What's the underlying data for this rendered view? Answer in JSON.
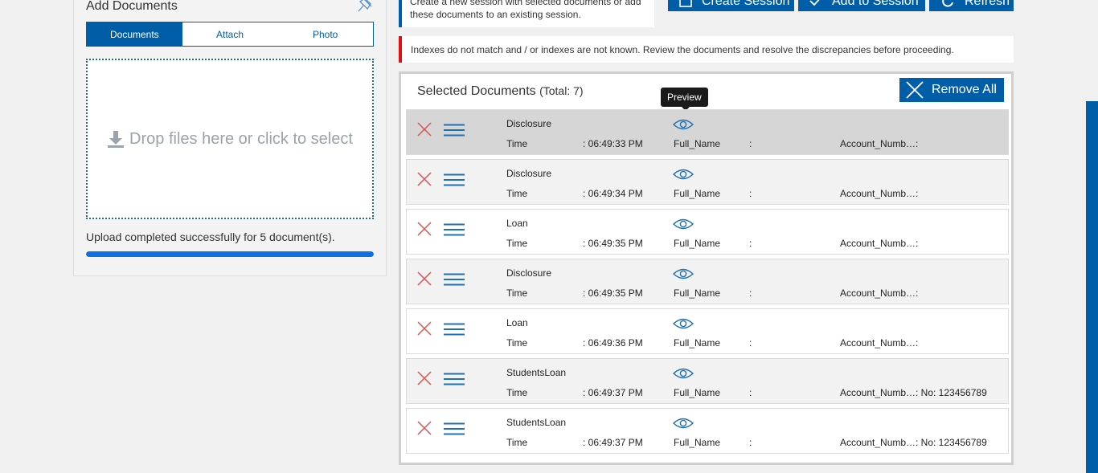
{
  "add_documents": {
    "title": "Add Documents",
    "tabs": [
      {
        "label": "Documents",
        "active": true
      },
      {
        "label": "Attach",
        "active": false
      },
      {
        "label": "Photo",
        "active": false
      }
    ],
    "dropzone_text": "Drop files here or click to select",
    "upload_message": "Upload completed successfully for 5 document(s).",
    "upload_progress": 1.0
  },
  "session_note": {
    "line1": "Create a new session with selected documents or add",
    "line2": "these documents to an existing session."
  },
  "toolbar": {
    "create_session": "Create Session",
    "add_to_session": "Add to Session",
    "refresh": "Refresh"
  },
  "warning": "Indexes do not match and / or indexes are not known. Review the documents and resolve the discrepancies before proceeding.",
  "selected_documents": {
    "title": "Selected Documents",
    "total": "(Total: 7)",
    "remove_all": "Remove All",
    "tooltip": "Preview",
    "field_labels": {
      "time": "Time",
      "full_name": "Full_Name",
      "account": "Account_Numb…"
    },
    "rows": [
      {
        "name": "Disclosure",
        "time": ": 06:49:33 PM",
        "full_name": ":",
        "account": ":"
      },
      {
        "name": "Disclosure",
        "time": ": 06:49:34 PM",
        "full_name": ":",
        "account": ":"
      },
      {
        "name": "Loan",
        "time": ": 06:49:35 PM",
        "full_name": ":",
        "account": ":"
      },
      {
        "name": "Disclosure",
        "time": ": 06:49:35 PM",
        "full_name": ":",
        "account": ":"
      },
      {
        "name": "Loan",
        "time": ": 06:49:36 PM",
        "full_name": ":",
        "account": ":"
      },
      {
        "name": "StudentsLoan",
        "time": ": 06:49:37 PM",
        "full_name": ":",
        "account": ": No: 123456789"
      },
      {
        "name": "StudentsLoan",
        "time": ": 06:49:37 PM",
        "full_name": ":",
        "account": ": No: 123456789"
      }
    ]
  },
  "colors": {
    "primary": "#005ea8",
    "alert": "#e01010",
    "delete_x": "#d9534f",
    "progress": "#0d6fe0"
  }
}
